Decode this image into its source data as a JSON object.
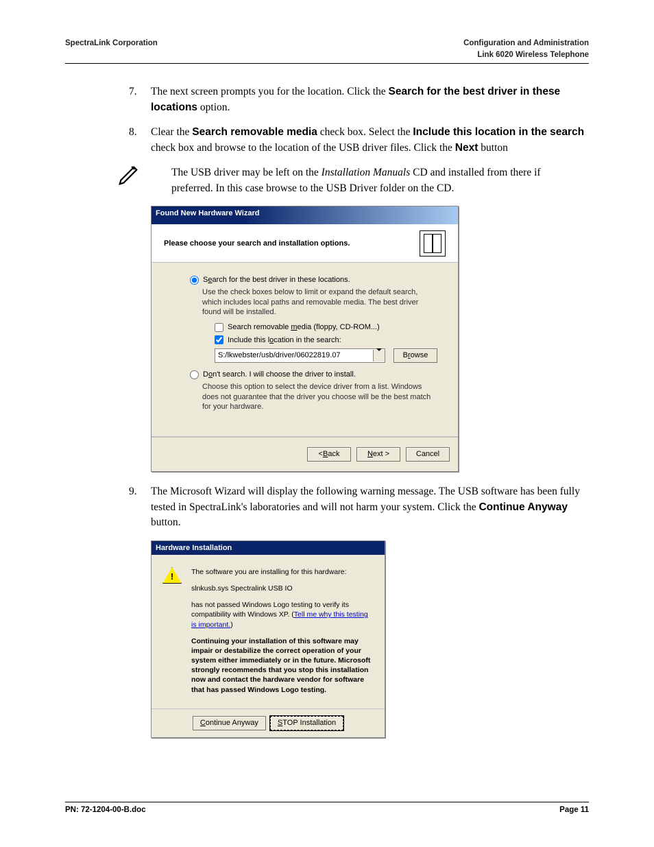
{
  "header": {
    "left": "SpectraLink Corporation",
    "right_line1": "Configuration and Administration",
    "right_line2": "Link 6020 Wireless Telephone"
  },
  "steps": {
    "n7": {
      "num": "7.",
      "pre": "The next screen prompts you for the location. Click the ",
      "bold": "Search for the best driver in these locations",
      "post": " option."
    },
    "n8": {
      "num": "8.",
      "t1": "Clear the ",
      "b1": "Search removable media",
      "t2": " check box. Select the ",
      "b2": "Include this location in the search",
      "t3": " check box and browse to the location of the USB driver files. Click the ",
      "b3": "Next",
      "t4": " button"
    },
    "note": {
      "p1a": "The USB driver may be left on the ",
      "p1i": "Installation Manuals",
      "p1b": " CD and installed from there if preferred. In this case browse to the USB Driver folder on the CD."
    },
    "n9": {
      "num": "9.",
      "t1": "The Microsoft Wizard will display the following warning message. The USB software has been fully tested in SpectraLink's laboratories and will not harm your system. Click the ",
      "b1": "Continue Anyway",
      "t2": " button."
    }
  },
  "dlg1": {
    "title": "Found New Hardware Wizard",
    "heading": "Please choose your search and installation options.",
    "opt1_pre": "S",
    "opt1_und": "e",
    "opt1_post": "arch for the best driver in these locations.",
    "opt1_desc": "Use the check boxes below to limit or expand the default search, which includes local paths and removable media. The best driver found will be installed.",
    "chk1_pre": "Search removable ",
    "chk1_und": "m",
    "chk1_post": "edia (floppy, CD-ROM...)",
    "chk2_pre": "Include this l",
    "chk2_und": "o",
    "chk2_post": "cation in the search:",
    "path": "S:/lkwebster/usb/driver/06022819.07",
    "browse_pre": "B",
    "browse_und": "r",
    "browse_post": "owse",
    "opt2_pre": "D",
    "opt2_und": "o",
    "opt2_post": "n't search. I will choose the driver to install.",
    "opt2_desc": "Choose this option to select the device driver from a list. Windows does not guarantee that the driver you choose will be the best match for your hardware.",
    "back_pre": "< ",
    "back_und": "B",
    "back_post": "ack",
    "next_pre": "",
    "next_und": "N",
    "next_post": "ext >",
    "cancel": "Cancel"
  },
  "dlg2": {
    "title": "Hardware Installation",
    "p1": "The software you are installing for this hardware:",
    "p2": "slnkusb.sys Spectralink USB IO",
    "p3a": "has not passed Windows Logo testing to verify its compatibility with Windows XP. (",
    "p3link": "Tell me why this testing is important.",
    "p3b": ")",
    "bold": "Continuing your installation of this software may impair or destabilize the correct operation of your system either immediately or in the future. Microsoft strongly recommends that you stop this installation now and contact the hardware vendor for software that has passed Windows Logo testing.",
    "btn1_pre": "",
    "btn1_und": "C",
    "btn1_post": "ontinue Anyway",
    "btn2_pre": "",
    "btn2_und": "S",
    "btn2_post": "TOP Installation"
  },
  "footer": {
    "left": "PN: 72-1204-00-B.doc",
    "right": "Page 11"
  }
}
